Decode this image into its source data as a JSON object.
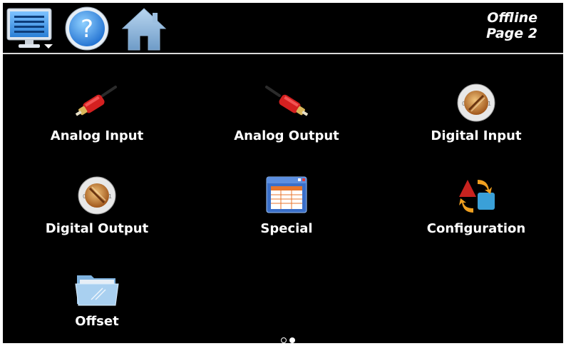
{
  "header": {
    "status_line1": "Offline",
    "status_line2": "Page 2",
    "icons": [
      "monitor-menu-icon",
      "help-icon",
      "home-icon"
    ]
  },
  "menu": {
    "items": [
      {
        "label": "Analog Input",
        "icon": "rca-cable-icon"
      },
      {
        "label": "Analog Output",
        "icon": "rca-cable-icon"
      },
      {
        "label": "Digital Input",
        "icon": "toggle-knob-icon"
      },
      {
        "label": "Digital Output",
        "icon": "toggle-knob-icon"
      },
      {
        "label": "Special",
        "icon": "window-table-icon"
      },
      {
        "label": "Configuration",
        "icon": "shapes-cycle-icon"
      },
      {
        "label": "Offset",
        "icon": "folder-icon"
      }
    ]
  },
  "pager": {
    "pages": 2,
    "current": 2
  },
  "colors": {
    "background": "#000000",
    "text": "#ffffff",
    "accent_blue": "#3a8ee6",
    "cable_red": "#d42020"
  }
}
